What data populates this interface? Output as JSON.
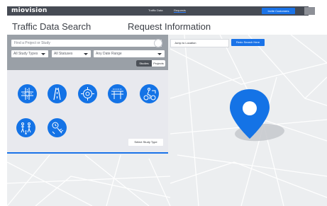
{
  "header": {
    "logo": "miovision",
    "nav": [
      {
        "label": "Traffic Data"
      },
      {
        "label": "Requests"
      }
    ],
    "invite_label": "Invite Customers"
  },
  "titles": {
    "left": "Traffic Data Search",
    "right": "Request Information"
  },
  "search": {
    "placeholder": "Find a Project or Study"
  },
  "filters": {
    "study_types": "All Study Types",
    "statuses": "All Statuses",
    "date_range": "Any Date Range"
  },
  "toggle": {
    "studies": "Studies",
    "projects": "Projects"
  },
  "study_types": [
    {
      "icon": "intersection-icon"
    },
    {
      "icon": "road-lanes-icon"
    },
    {
      "icon": "roundabout-icon"
    },
    {
      "icon": "bridge-icon"
    },
    {
      "icon": "bicycle-icon"
    },
    {
      "icon": "pedestrians-icon"
    },
    {
      "icon": "speed-gauge-icon"
    }
  ],
  "select_study_label": "Select Study Type",
  "map": {
    "jump_label": "Jump to Location",
    "redo_label": "Redo Search Here"
  },
  "colors": {
    "accent": "#1a73e8",
    "topbar": "#464b54",
    "panel_header": "#9aa0a7",
    "map_bg": "#eceef0"
  }
}
